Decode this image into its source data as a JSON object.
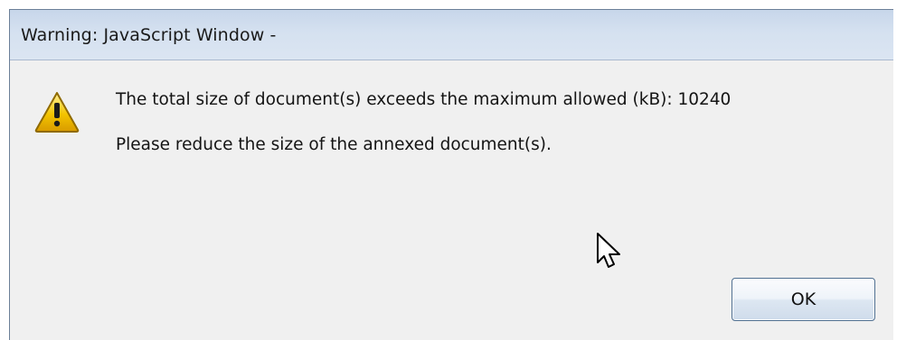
{
  "dialog": {
    "title": "Warning: JavaScript Window -",
    "message_lines": [
      "The total size of document(s) exceeds the maximum allowed (kB): 10240",
      "Please reduce the size of the annexed document(s)."
    ],
    "ok_button_label": "OK",
    "icon": "warning-icon"
  },
  "colors": {
    "title_text": "#1a1a1a",
    "dialog_bg": "#f0f0f0",
    "button_border": "#4f6f91",
    "warning_fill": "#f3c400"
  },
  "cursor": {
    "icon": "mouse-pointer-icon"
  }
}
